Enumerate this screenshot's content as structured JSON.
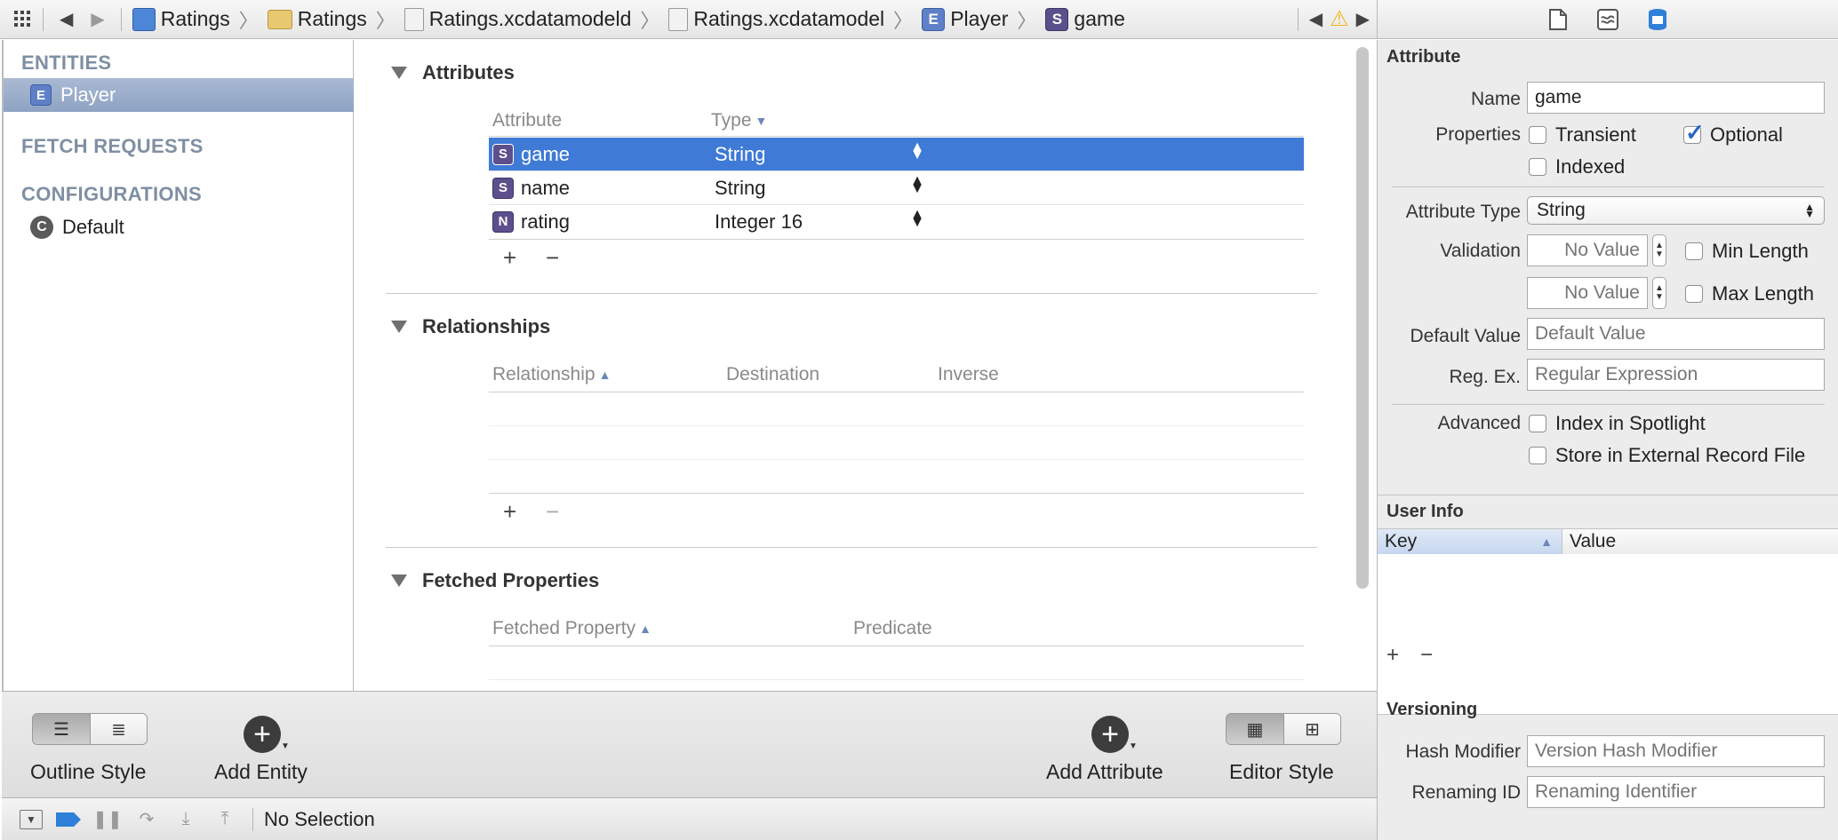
{
  "jumpbar": {
    "crumbs": [
      "Ratings",
      "Ratings",
      "Ratings.xcdatamodeld",
      "Ratings.xcdatamodel",
      "Player",
      "game"
    ],
    "icon_letters": {
      "entity": "E",
      "attribute": "S"
    }
  },
  "left": {
    "entities_header": "ENTITIES",
    "entities": [
      {
        "letter": "E",
        "label": "Player"
      }
    ],
    "fetch_header": "FETCH REQUESTS",
    "config_header": "CONFIGURATIONS",
    "configs": [
      {
        "letter": "C",
        "label": "Default"
      }
    ]
  },
  "attributes": {
    "title": "Attributes",
    "col_attr": "Attribute",
    "col_type": "Type",
    "rows": [
      {
        "letter": "S",
        "name": "game",
        "type": "String"
      },
      {
        "letter": "S",
        "name": "name",
        "type": "String"
      },
      {
        "letter": "N",
        "name": "rating",
        "type": "Integer 16"
      }
    ]
  },
  "relationships": {
    "title": "Relationships",
    "col_rel": "Relationship",
    "col_dest": "Destination",
    "col_inv": "Inverse"
  },
  "fetched": {
    "title": "Fetched Properties",
    "col_prop": "Fetched Property",
    "col_pred": "Predicate"
  },
  "bottom": {
    "outline_style": "Outline Style",
    "add_entity": "Add Entity",
    "add_attribute": "Add Attribute",
    "editor_style": "Editor Style"
  },
  "status": {
    "text": "No Selection"
  },
  "inspector": {
    "attribute_header": "Attribute",
    "name_label": "Name",
    "name_value": "game",
    "properties_label": "Properties",
    "transient": "Transient",
    "optional": "Optional",
    "indexed": "Indexed",
    "attr_type_label": "Attribute Type",
    "attr_type_value": "String",
    "validation_label": "Validation",
    "no_value": "No Value",
    "min_length": "Min Length",
    "max_length": "Max Length",
    "default_label": "Default Value",
    "default_ph": "Default Value",
    "regex_label": "Reg. Ex.",
    "regex_ph": "Regular Expression",
    "advanced_label": "Advanced",
    "index_spotlight": "Index in Spotlight",
    "store_external": "Store in External Record File",
    "user_info_header": "User Info",
    "key_col": "Key",
    "value_col": "Value",
    "versioning_header": "Versioning",
    "hash_label": "Hash Modifier",
    "hash_ph": "Version Hash Modifier",
    "renaming_label": "Renaming ID",
    "renaming_ph": "Renaming Identifier"
  }
}
